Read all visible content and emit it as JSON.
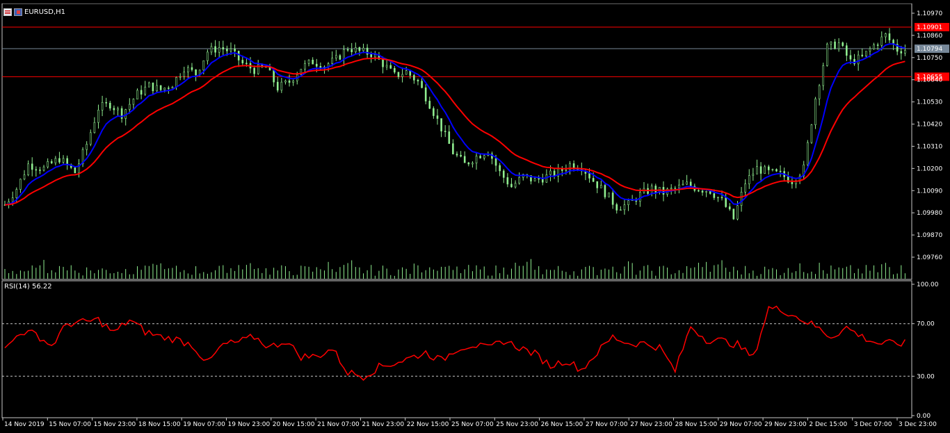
{
  "window": {
    "symbol_label": "EURUSD,H1",
    "rsi_label": "RSI(14) 56.22"
  },
  "colors": {
    "background": "#000000",
    "frame": "#c8c8c8",
    "candles": "#90ee90",
    "ma_fast": "#0000ff",
    "ma_slow": "#ff0000",
    "rsi_line": "#ff0000",
    "level_line": "#c00000",
    "bid_line": "#778899"
  },
  "chart_data": [
    {
      "type": "candlestick",
      "title": "EURUSD,H1",
      "ylim": [
        1.0972,
        1.11
      ],
      "y_ticks": [
        "1.10970",
        "1.10860",
        "1.10750",
        "1.10640",
        "1.10530",
        "1.10420",
        "1.10310",
        "1.10200",
        "1.10090",
        "1.09980",
        "1.09870",
        "1.09760"
      ],
      "x_ticks": [
        "14 Nov 2019",
        "15 Nov 07:00",
        "15 Nov 23:00",
        "18 Nov 15:00",
        "19 Nov 07:00",
        "19 Nov 23:00",
        "20 Nov 15:00",
        "21 Nov 07:00",
        "21 Nov 23:00",
        "22 Nov 15:00",
        "25 Nov 07:00",
        "25 Nov 23:00",
        "26 Nov 15:00",
        "27 Nov 07:00",
        "27 Nov 23:00",
        "28 Nov 15:00",
        "29 Nov 07:00",
        "29 Nov 23:00",
        "2 Dec 15:00",
        "3 Dec 07:00",
        "3 Dec 23:00"
      ],
      "horizontal_levels": [
        {
          "label": "1.10901",
          "value": 1.10901,
          "color": "#ff0000"
        },
        {
          "label": "1.10794",
          "value": 1.10794,
          "color": "#778899"
        },
        {
          "label": "1.10655",
          "value": 1.10655,
          "color": "#ff0000"
        }
      ],
      "price_path": [
        [
          0,
          1.1002
        ],
        [
          3,
          1.101
        ],
        [
          6,
          1.1022
        ],
        [
          10,
          1.102
        ],
        [
          14,
          1.1025
        ],
        [
          18,
          1.1018
        ],
        [
          21,
          1.1032
        ],
        [
          24,
          1.105
        ],
        [
          27,
          1.1052
        ],
        [
          30,
          1.1047
        ],
        [
          34,
          1.1057
        ],
        [
          37,
          1.1061
        ],
        [
          40,
          1.1059
        ],
        [
          43,
          1.1062
        ],
        [
          46,
          1.107
        ],
        [
          49,
          1.1067
        ],
        [
          52,
          1.1078
        ],
        [
          55,
          1.108
        ],
        [
          58,
          1.1078
        ],
        [
          61,
          1.1072
        ],
        [
          64,
          1.1069
        ],
        [
          67,
          1.107
        ],
        [
          70,
          1.106
        ],
        [
          73,
          1.1063
        ],
        [
          76,
          1.107
        ],
        [
          79,
          1.1073
        ],
        [
          82,
          1.1071
        ],
        [
          85,
          1.1074
        ],
        [
          88,
          1.108
        ],
        [
          91,
          1.1078
        ],
        [
          94,
          1.1077
        ],
        [
          97,
          1.1072
        ],
        [
          100,
          1.1066
        ],
        [
          103,
          1.1068
        ],
        [
          106,
          1.1063
        ],
        [
          109,
          1.1052
        ],
        [
          112,
          1.104
        ],
        [
          115,
          1.1028
        ],
        [
          118,
          1.1022
        ],
        [
          121,
          1.1026
        ],
        [
          124,
          1.1029
        ],
        [
          127,
          1.1018
        ],
        [
          130,
          1.1011
        ],
        [
          133,
          1.1016
        ],
        [
          136,
          1.1014
        ],
        [
          139,
          1.1016
        ],
        [
          142,
          1.1018
        ],
        [
          145,
          1.1022
        ],
        [
          148,
          1.1021
        ],
        [
          151,
          1.1014
        ],
        [
          154,
          1.1008
        ],
        [
          157,
          1.1001
        ],
        [
          160,
          1.1002
        ],
        [
          163,
          1.1007
        ],
        [
          166,
          1.101
        ],
        [
          169,
          1.1008
        ],
        [
          172,
          1.101
        ],
        [
          175,
          1.1012
        ],
        [
          178,
          1.101
        ],
        [
          181,
          1.1009
        ],
        [
          184,
          1.1004
        ],
        [
          187,
          1.0995
        ],
        [
          190,
          1.1013
        ],
        [
          193,
          1.102
        ],
        [
          196,
          1.1018
        ],
        [
          199,
          1.1017
        ],
        [
          202,
          1.1014
        ],
        [
          205,
          1.102
        ],
        [
          208,
          1.1055
        ],
        [
          211,
          1.108
        ],
        [
          214,
          1.1082
        ],
        [
          217,
          1.1073
        ],
        [
          220,
          1.1075
        ],
        [
          223,
          1.1081
        ],
        [
          226,
          1.1086
        ],
        [
          229,
          1.1079
        ]
      ],
      "volume": "histogram, unlabeled"
    },
    {
      "type": "line",
      "title": "RSI(14) 56.22",
      "ylim": [
        0,
        100
      ],
      "y_ticks": [
        "100.00",
        "70.00",
        "30.00",
        "0.00"
      ],
      "levels": [
        70,
        30
      ],
      "rsi_path": [
        [
          0,
          50
        ],
        [
          4,
          64
        ],
        [
          8,
          62
        ],
        [
          12,
          53
        ],
        [
          16,
          70
        ],
        [
          20,
          71
        ],
        [
          24,
          73
        ],
        [
          28,
          63
        ],
        [
          32,
          73
        ],
        [
          36,
          64
        ],
        [
          40,
          60
        ],
        [
          44,
          58
        ],
        [
          48,
          54
        ],
        [
          52,
          40
        ],
        [
          56,
          54
        ],
        [
          60,
          56
        ],
        [
          64,
          60
        ],
        [
          68,
          52
        ],
        [
          72,
          57
        ],
        [
          76,
          45
        ],
        [
          80,
          45
        ],
        [
          84,
          51
        ],
        [
          88,
          33
        ],
        [
          92,
          30
        ],
        [
          96,
          37
        ],
        [
          100,
          40
        ],
        [
          104,
          44
        ],
        [
          108,
          48
        ],
        [
          112,
          42
        ],
        [
          116,
          51
        ],
        [
          120,
          54
        ],
        [
          124,
          51
        ],
        [
          128,
          57
        ],
        [
          132,
          52
        ],
        [
          136,
          47
        ],
        [
          140,
          38
        ],
        [
          144,
          42
        ],
        [
          148,
          35
        ],
        [
          152,
          48
        ],
        [
          156,
          60
        ],
        [
          160,
          55
        ],
        [
          164,
          55
        ],
        [
          168,
          52
        ],
        [
          172,
          34
        ],
        [
          176,
          68
        ],
        [
          180,
          58
        ],
        [
          184,
          57
        ],
        [
          188,
          54
        ],
        [
          192,
          44
        ],
        [
          196,
          82
        ],
        [
          200,
          80
        ],
        [
          204,
          74
        ],
        [
          208,
          68
        ],
        [
          212,
          60
        ],
        [
          216,
          67
        ],
        [
          220,
          60
        ],
        [
          224,
          55
        ]
      ]
    }
  ]
}
